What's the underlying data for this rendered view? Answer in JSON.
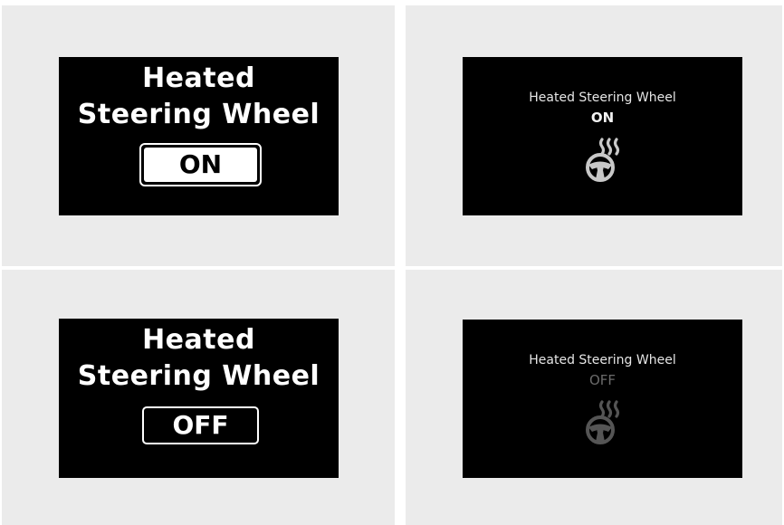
{
  "panels": {
    "top_left": {
      "title_line1": "Heated",
      "title_line2": "Steering Wheel",
      "state": "ON"
    },
    "top_right": {
      "title": "Heated Steering Wheel",
      "state": "ON",
      "icon": "heated-steering-wheel-icon",
      "icon_color": "#c8c8c8"
    },
    "bottom_left": {
      "title_line1": "Heated",
      "title_line2": "Steering Wheel",
      "state": "OFF"
    },
    "bottom_right": {
      "title": "Heated Steering Wheel",
      "state": "OFF",
      "icon": "heated-steering-wheel-icon",
      "icon_color": "#555555"
    }
  },
  "colors": {
    "panel_bg": "#ebebeb",
    "screen_bg": "#000000",
    "on_text": "#ffffff",
    "off_dim": "#6a6a6a"
  }
}
